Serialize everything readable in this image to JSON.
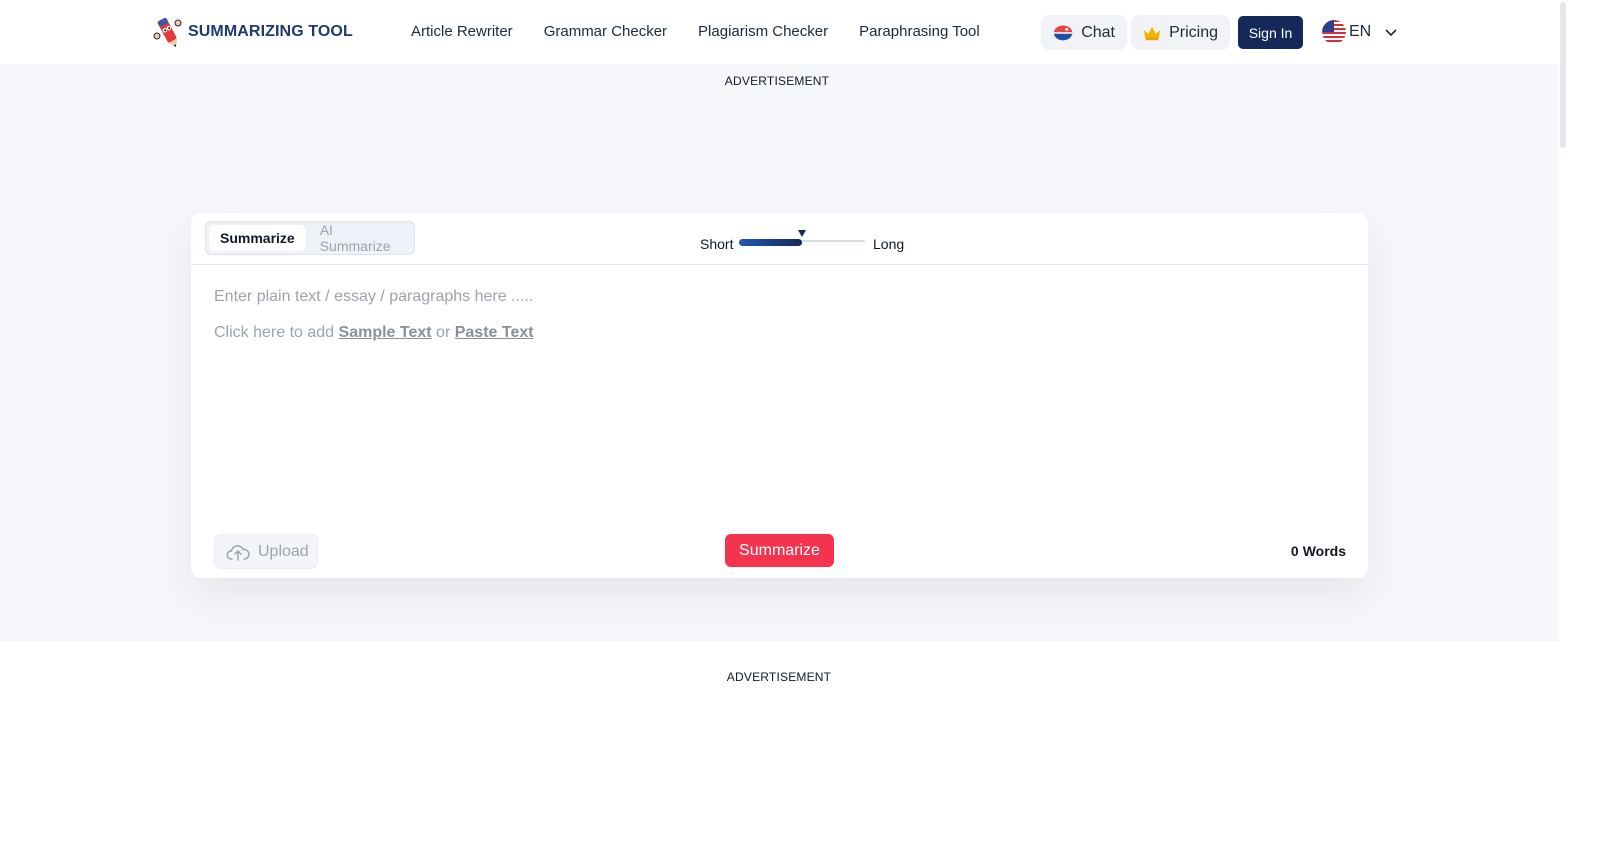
{
  "brand": {
    "name": "SUMMARIZING TOOL"
  },
  "nav": [
    {
      "label": "Article Rewriter"
    },
    {
      "label": "Grammar Checker"
    },
    {
      "label": "Plagiarism Checker"
    },
    {
      "label": "Paraphrasing Tool"
    }
  ],
  "header": {
    "chat_label": "Chat",
    "pricing_label": "Pricing",
    "signin_label": "Sign In",
    "language": "EN"
  },
  "ads": {
    "top": "ADVERTISEMENT",
    "bottom": "ADVERTISEMENT"
  },
  "tabs": [
    {
      "label": "Summarize",
      "active": true
    },
    {
      "label": "AI Summarize",
      "active": false
    }
  ],
  "length_slider": {
    "min_label": "Short",
    "max_label": "Long",
    "value": 0.5
  },
  "editor": {
    "placeholder": "Enter plain text / essay / paragraphs here .....",
    "hint_prefix": "Click here to add ",
    "sample_link": "Sample Text",
    "hint_or": " or ",
    "paste_link": "Paste Text"
  },
  "actions": {
    "upload_label": "Upload",
    "summarize_label": "Summarize"
  },
  "word_count": {
    "value": "0",
    "unit": "Words"
  },
  "colors": {
    "primary_navy": "#14295a",
    "accent_red": "#f4344f",
    "band_bg": "#f6f7fb"
  }
}
